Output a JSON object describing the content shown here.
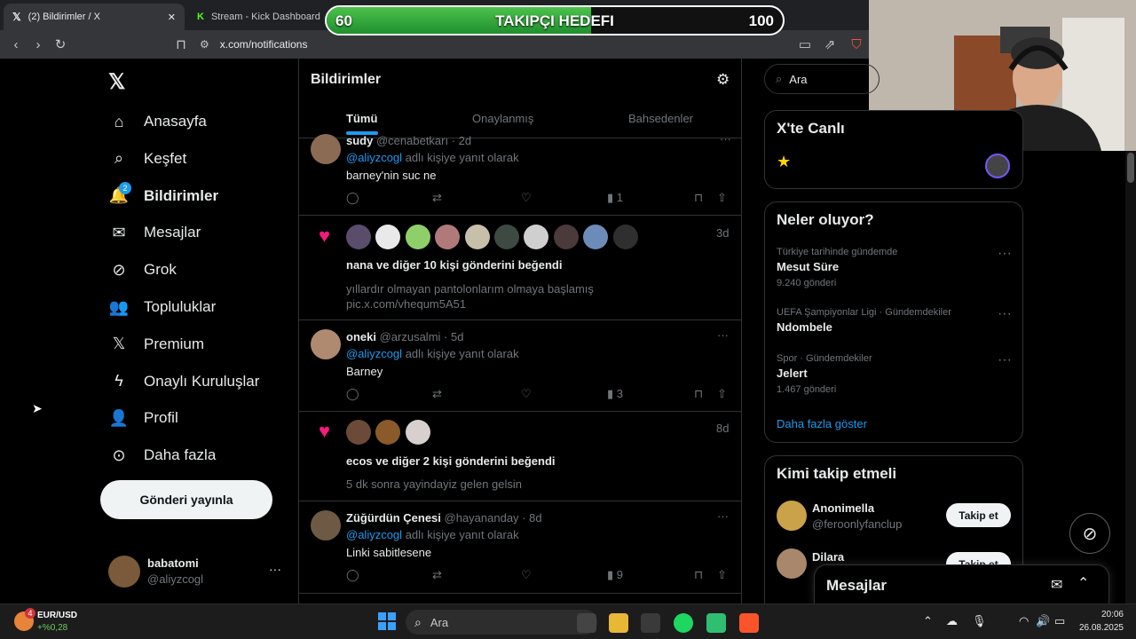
{
  "browser": {
    "tabs": [
      {
        "title": "(2) Bildirimler / X"
      },
      {
        "title": "Stream - Kick Dashboard"
      }
    ],
    "url": "x.com/notifications"
  },
  "overlay": {
    "start": "60",
    "label": "TAKIPÇI HEDEFI",
    "end": "100",
    "progress": 0.58
  },
  "sidebar": {
    "items": [
      {
        "label": "Anasayfa",
        "icon": "home-icon"
      },
      {
        "label": "Keşfet",
        "icon": "search-icon"
      },
      {
        "label": "Bildirimler",
        "icon": "bell-icon",
        "badge": "2"
      },
      {
        "label": "Mesajlar",
        "icon": "mail-icon"
      },
      {
        "label": "Grok",
        "icon": "grok-icon"
      },
      {
        "label": "Topluluklar",
        "icon": "communities-icon"
      },
      {
        "label": "Premium",
        "icon": "x-logo-icon"
      },
      {
        "label": "Onaylı Kuruluşlar",
        "icon": "lightning-icon"
      },
      {
        "label": "Profil",
        "icon": "profile-icon"
      },
      {
        "label": "Daha fazla",
        "icon": "more-circle-icon"
      }
    ],
    "post_button": "Gönderi yayınla",
    "account": {
      "name": "babatomi",
      "handle": "@aliyzcogl"
    }
  },
  "main": {
    "title": "Bildirimler",
    "tabs": [
      "Tümü",
      "Onaylanmış",
      "Bahsedenler"
    ],
    "notifications": [
      {
        "type": "reply",
        "name": "sudy",
        "handle": "@cenabetkarı · 2d",
        "reply_to": "@aliyzcogl",
        "reply_suffix": "adlı kişiye yanıt olarak",
        "text": "barney'nin suc ne",
        "views": "1"
      },
      {
        "type": "like",
        "time": "3d",
        "summary_name": "nana",
        "summary_rest": "ve diğer 10 kişi gönderini beğendi",
        "text_1": "yıllardır olmayan pantolonlarım olmaya başlamış",
        "text_2": "pic.x.com/vhequm5A51"
      },
      {
        "type": "reply",
        "name": "oneki",
        "handle": "@arzusalmi · 5d",
        "reply_to": "@aliyzcogl",
        "reply_suffix": "adlı kişiye yanıt olarak",
        "text": "Barney",
        "views": "3"
      },
      {
        "type": "like",
        "time": "8d",
        "summary_name": "ecos",
        "summary_rest": "ve diğer 2 kişi gönderini beğendi",
        "text_1": "5 dk sonra yayindayiz gelen gelsin"
      },
      {
        "type": "reply",
        "name": "Züğürdün Çenesi",
        "handle": "@hayananday · 8d",
        "reply_to": "@aliyzcogl",
        "reply_suffix": "adlı kişiye yanıt olarak",
        "text": "Linki sabitlesene",
        "views": "9"
      }
    ]
  },
  "right": {
    "search_placeholder": "Ara",
    "live_title": "X'te Canlı",
    "trends_title": "Neler oluyor?",
    "trends": [
      {
        "context": "Türkiye tarihinde gündemde",
        "name": "Mesut Süre",
        "count": "9.240 gönderi"
      },
      {
        "context": "UEFA Şampiyonlar Ligi · Gündemdekiler",
        "name": "Ndombele",
        "count": ""
      },
      {
        "context": "Spor · Gündemdekiler",
        "name": "Jelert",
        "count": "1.467 gönderi"
      }
    ],
    "show_more": "Daha fazla göster",
    "who_title": "Kimi takip etmeli",
    "who": [
      {
        "name": "Anonimella",
        "handle": "@feroonlyfanclup",
        "button": "Takip et"
      },
      {
        "name": "Dilara",
        "handle": "",
        "button": "Takip et"
      }
    ],
    "messages_title": "Mesajlar"
  },
  "taskbar": {
    "ticker": "EUR/USD",
    "ticker_change": "+%0,28",
    "ticker_badge": "4",
    "search": "Ara",
    "time": "20:06",
    "date": "26.08.2025"
  }
}
